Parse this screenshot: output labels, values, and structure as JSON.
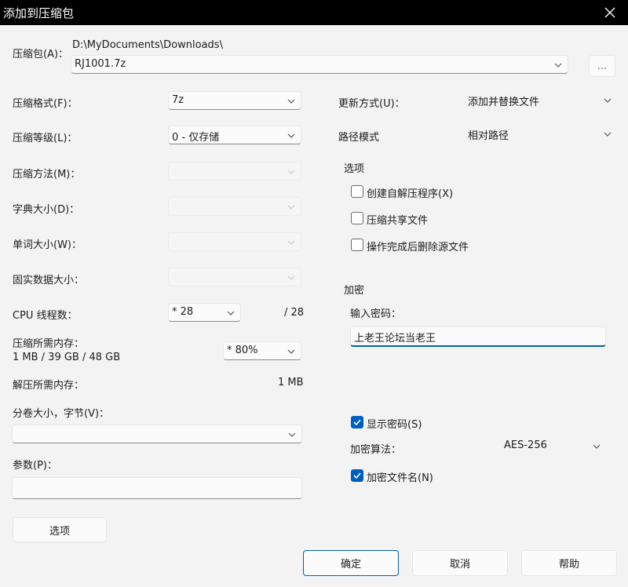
{
  "window": {
    "title": "添加到压缩包"
  },
  "archive": {
    "label": "压缩包(A)：",
    "path": "D:\\MyDocuments\\Downloads\\",
    "filename": "RJ1001.7z",
    "browse_label": "..."
  },
  "left": {
    "format_label": "压缩格式(F)：",
    "format_value": "7z",
    "level_label": "压缩等级(L)：",
    "level_value": "0 - 仅存储",
    "method_label": "压缩方法(M)：",
    "dict_label": "字典大小(D)：",
    "word_label": "单词大小(W)：",
    "solid_label": "固实数据大小：",
    "cpu_label": "CPU 线程数：",
    "cpu_value": "* 28",
    "cpu_total": "/ 28",
    "mem_label": "压缩所需内存：",
    "mem_info": "1 MB / 39 GB / 48 GB",
    "mem_value": "* 80%",
    "decomp_label": "解压所需内存：",
    "decomp_value": "1 MB",
    "split_label": "分卷大小，字节(V)：",
    "params_label": "参数(P)：",
    "options_button": "选项"
  },
  "right": {
    "update_label": "更新方式(U)：",
    "update_value": "添加并替换文件",
    "path_label": "路径模式",
    "path_value": "相对路径",
    "options_title": "选项",
    "opt_sfx": "创建自解压程序(X)",
    "opt_shared": "压缩共享文件",
    "opt_delete": "操作完成后删除源文件",
    "encrypt_title": "加密",
    "password_label": "输入密码：",
    "password_value": "上老王论坛当老王",
    "show_password": "显示密码(S)",
    "algo_label": "加密算法：",
    "algo_value": "AES-256",
    "encrypt_names": "加密文件名(N)"
  },
  "buttons": {
    "ok": "确定",
    "cancel": "取消",
    "help": "帮助"
  },
  "colors": {
    "accent": "#005fb8",
    "titlebar": "#000000"
  }
}
